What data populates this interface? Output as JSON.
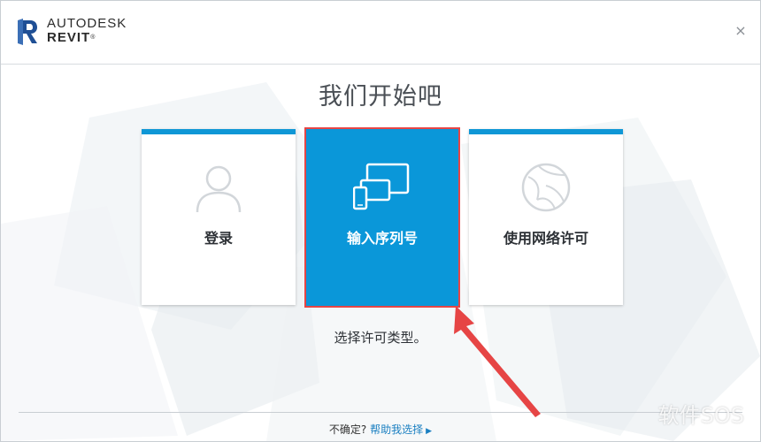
{
  "header": {
    "brand_line1": "AUTODESK",
    "brand_line2": "REVIT",
    "close_symbol": "×"
  },
  "main": {
    "heading": "我们开始吧",
    "cards": [
      {
        "label": "登录",
        "icon": "user-silhouette-icon",
        "selected": false
      },
      {
        "label": "输入序列号",
        "icon": "devices-icon",
        "selected": true
      },
      {
        "label": "使用网络许可",
        "icon": "network-globe-icon",
        "selected": false
      }
    ],
    "hint": "选择许可类型。"
  },
  "footer": {
    "question": "不确定?",
    "help_link": "帮助我选择",
    "link_arrow": "▶"
  },
  "watermark": "软件SOS",
  "colors": {
    "accent": "#0f97d6",
    "selected_bg": "#0a97d9",
    "highlight_red": "#e64545",
    "link": "#1a7fc1"
  }
}
